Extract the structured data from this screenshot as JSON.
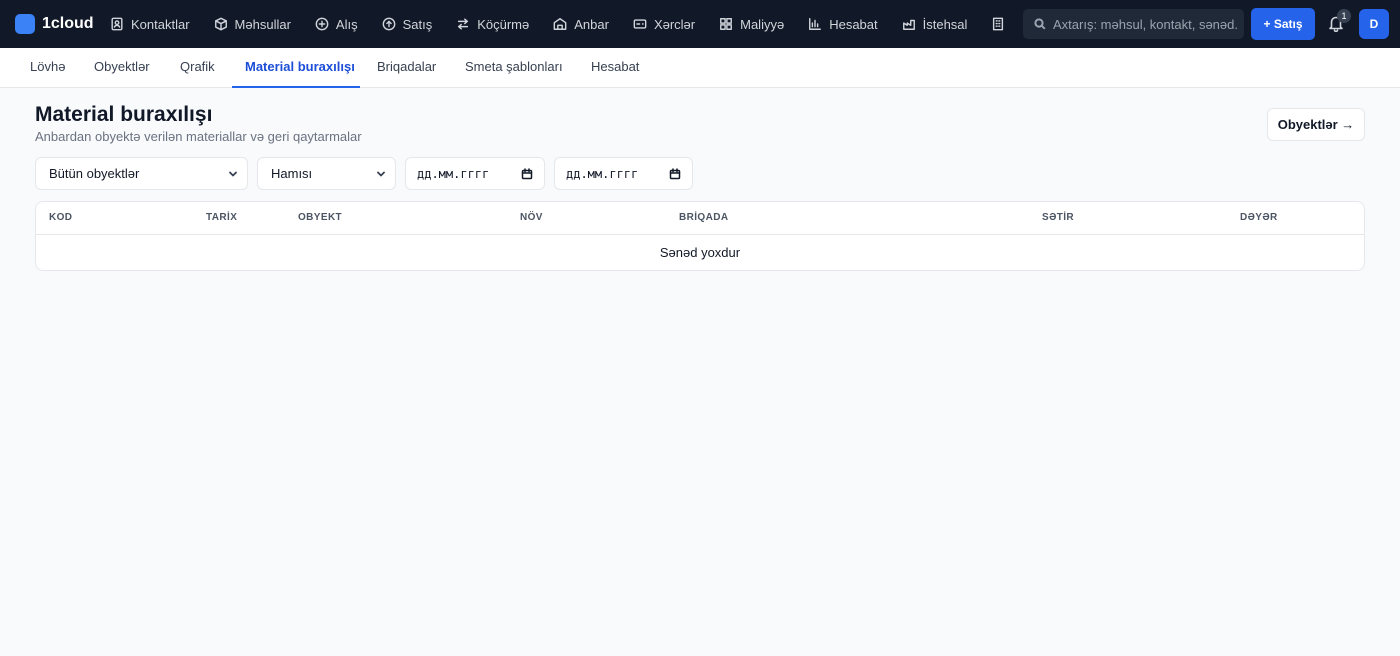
{
  "brand": {
    "name": "1cloud",
    "logo_color": "#3b82f6"
  },
  "nav": {
    "items": [
      {
        "label": "Kontaktlar",
        "icon": "contacts-icon"
      },
      {
        "label": "Məhsullar",
        "icon": "box-icon"
      },
      {
        "label": "Alış",
        "icon": "plus-circle-icon"
      },
      {
        "label": "Satış",
        "icon": "arrow-circle-icon"
      },
      {
        "label": "Köçürmə",
        "icon": "transfer-icon"
      },
      {
        "label": "Anbar",
        "icon": "warehouse-icon"
      },
      {
        "label": "Xərclər",
        "icon": "wallet-icon"
      },
      {
        "label": "Maliyyə",
        "icon": "grid-icon"
      },
      {
        "label": "Hesabat",
        "icon": "bar-chart-icon"
      },
      {
        "label": "İstehsal",
        "icon": "factory-icon"
      }
    ],
    "overflow_icon": "building-icon"
  },
  "search": {
    "placeholder": "Axtarış: məhsul, kontakt, sənəd..."
  },
  "new_sale": {
    "label": "+ Satış"
  },
  "notifications": {
    "badge": "1"
  },
  "user": {
    "initial": "D"
  },
  "subnav": {
    "tabs": [
      {
        "label": "Lövhə"
      },
      {
        "label": "Obyektlər"
      },
      {
        "label": "Qrafik"
      },
      {
        "label": "Material buraxılışı",
        "active": true
      },
      {
        "label": "Briqadalar"
      },
      {
        "label": "Smeta şablonları"
      },
      {
        "label": "Hesabat"
      }
    ]
  },
  "page": {
    "title": "Material buraxılışı",
    "subtitle": "Anbardan obyektə verilən materiallar və geri qaytarmalar",
    "link_button": "Obyektlər →"
  },
  "filters": {
    "object": "Bütün obyektlər",
    "type": "Hamısı",
    "date_from": "дд.мм.гггг",
    "date_to": "дд.мм.гггг"
  },
  "table": {
    "columns": [
      "KOD",
      "TARİX",
      "OBYEKT",
      "NÖV",
      "BRİQADA",
      "SƏTİR",
      "DƏYƏR"
    ],
    "empty_text": "Sənəd yoxdur"
  },
  "colors": {
    "topbar": "#111827",
    "accent": "#2563eb",
    "background": "#f8fafc"
  }
}
